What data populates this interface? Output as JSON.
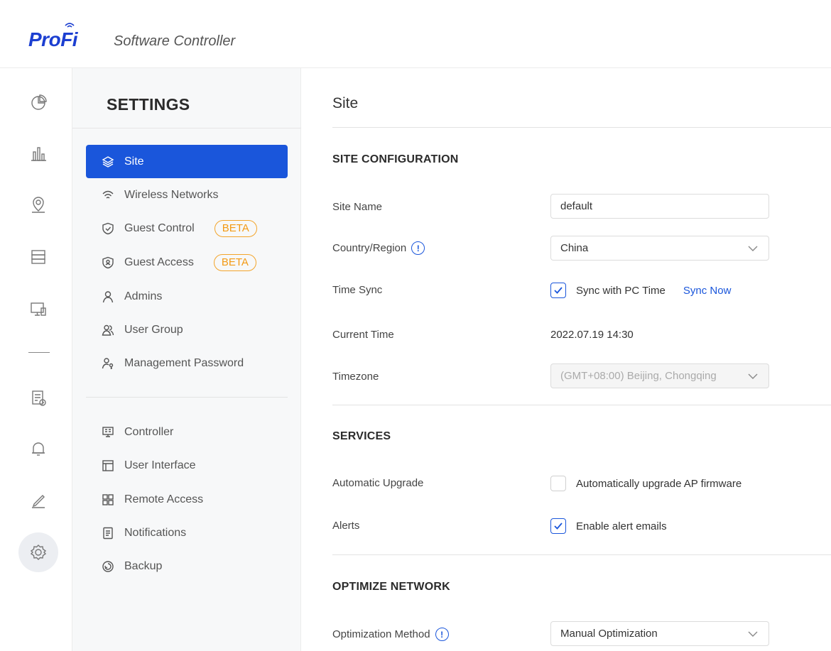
{
  "header": {
    "logo": {
      "part1": "Pro",
      "part2": "Fi"
    },
    "app_title": "Software Controller"
  },
  "rail": {
    "items": [
      "dashboard-icon",
      "statistics-icon",
      "map-icon",
      "devices-icon",
      "clients-icon",
      "insights-icon",
      "logs-icon",
      "alerts-icon",
      "edit-icon",
      "settings-icon"
    ],
    "active": "settings-icon"
  },
  "settings_nav": {
    "title": "SETTINGS",
    "items": [
      {
        "label": "Site",
        "icon": "layers-icon",
        "active": true
      },
      {
        "label": "Wireless Networks",
        "icon": "wifi-icon"
      },
      {
        "label": "Guest Control",
        "icon": "shield-check-icon",
        "badge": "BETA"
      },
      {
        "label": "Guest Access",
        "icon": "shield-user-icon",
        "badge": "BETA"
      },
      {
        "label": "Admins",
        "icon": "user-icon"
      },
      {
        "label": "User Group",
        "icon": "user-group-icon"
      },
      {
        "label": "Management Password",
        "icon": "user-key-icon"
      },
      {
        "label": "Controller",
        "icon": "controller-icon"
      },
      {
        "label": "User Interface",
        "icon": "layout-icon"
      },
      {
        "label": "Remote Access",
        "icon": "remote-icon"
      },
      {
        "label": "Notifications",
        "icon": "document-icon"
      },
      {
        "label": "Backup",
        "icon": "backup-icon"
      }
    ]
  },
  "main": {
    "title": "Site",
    "site_config": {
      "title": "SITE CONFIGURATION",
      "site_name_label": "Site Name",
      "site_name_value": "default",
      "country_label": "Country/Region",
      "country_value": "China",
      "time_sync_label": "Time Sync",
      "time_sync_checkbox": "Sync with PC Time",
      "time_sync_checked": true,
      "sync_now": "Sync Now",
      "current_time_label": "Current Time",
      "current_time_value": "2022.07.19 14:30",
      "timezone_label": "Timezone",
      "timezone_value": "(GMT+08:00) Beijing, Chongqing"
    },
    "services": {
      "title": "SERVICES",
      "auto_upgrade_label": "Automatic Upgrade",
      "auto_upgrade_checkbox": "Automatically upgrade AP firmware",
      "auto_upgrade_checked": false,
      "alerts_label": "Alerts",
      "alerts_checkbox": "Enable alert emails",
      "alerts_checked": true
    },
    "optimize": {
      "title": "OPTIMIZE NETWORK",
      "method_label": "Optimization Method",
      "method_value": "Manual Optimization"
    }
  },
  "colors": {
    "accent": "#1a56db",
    "beta": "#f39a15",
    "logo": "#1c3fd1"
  }
}
